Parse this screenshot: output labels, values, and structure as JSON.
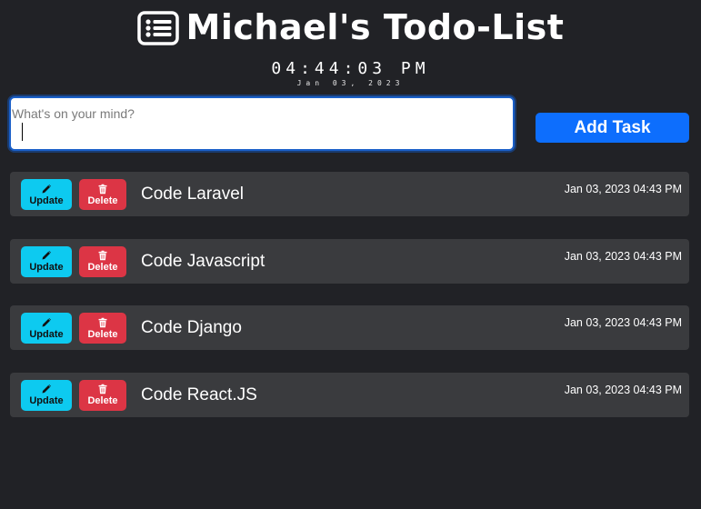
{
  "header": {
    "title": "Michael's Todo-List",
    "icon": "list-icon",
    "clock": "04:44:03 PM",
    "date": "Jan 03, 2023"
  },
  "form": {
    "placeholder": "What's on your mind?",
    "value": "",
    "add_label": "Add Task"
  },
  "colors": {
    "background": "#212226",
    "row": "#3a3b3e",
    "primary": "#0d6efd",
    "update": "#0dcaf0",
    "delete": "#dc3545"
  },
  "tasks": [
    {
      "name": "Code Laravel",
      "time": "Jan 03, 2023 04:43 PM",
      "update_label": "Update",
      "delete_label": "Delete"
    },
    {
      "name": "Code Javascript",
      "time": "Jan 03, 2023 04:43 PM",
      "update_label": "Update",
      "delete_label": "Delete"
    },
    {
      "name": "Code Django",
      "time": "Jan 03, 2023 04:43 PM",
      "update_label": "Update",
      "delete_label": "Delete"
    },
    {
      "name": "Code React.JS",
      "time": "Jan 03, 2023 04:43 PM",
      "update_label": "Update",
      "delete_label": "Delete"
    }
  ]
}
